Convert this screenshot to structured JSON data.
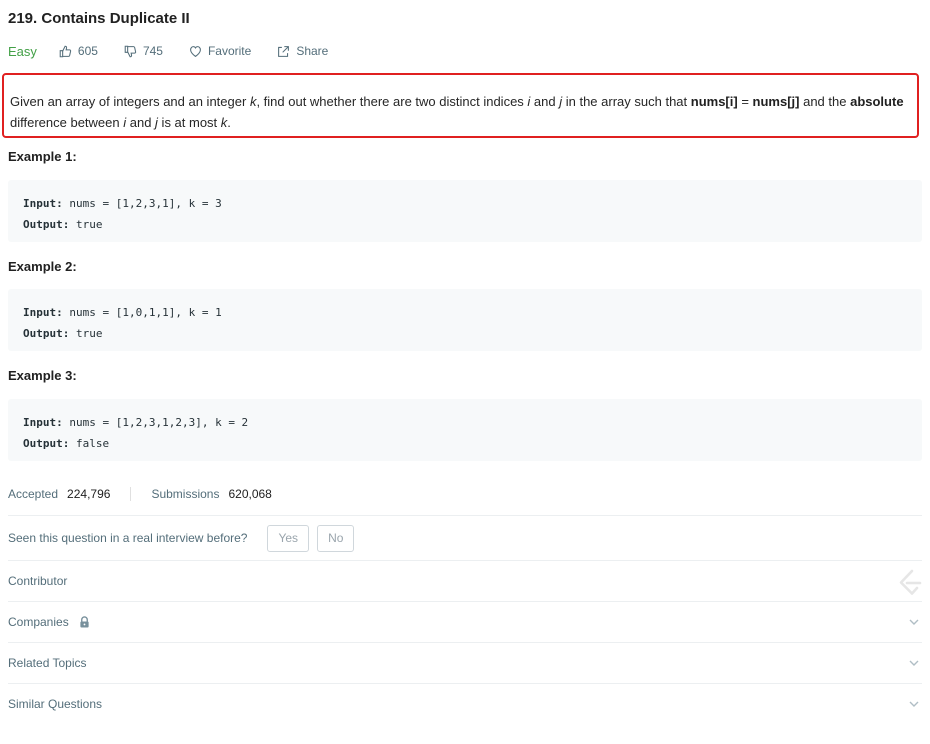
{
  "problem": {
    "title": "219. Contains Duplicate II",
    "difficulty": "Easy",
    "likes": "605",
    "dislikes": "745",
    "favorite_label": "Favorite",
    "share_label": "Share"
  },
  "description": {
    "t1": "Given an array of integers and an integer ",
    "k1": "k",
    "t2": ", find out whether there are two distinct indices ",
    "i1": "i",
    "t3": " and ",
    "j1": "j",
    "t4": " in the array such that ",
    "b1": "nums[i]",
    "t5": " = ",
    "b2": "nums[j]",
    "t6": " and the ",
    "b3": "absolute",
    "t7": " difference between ",
    "i2": "i",
    "t8": " and ",
    "j2": "j",
    "t9": " is at most ",
    "k2": "k",
    "t10": "."
  },
  "examples": [
    {
      "title": "Example 1:",
      "input_label": "Input:",
      "input": " nums = [1,2,3,1], k = 3",
      "output_label": "Output:",
      "output": " true"
    },
    {
      "title": "Example 2:",
      "input_label": "Input:",
      "input": " nums = [1,0,1,1], k = 1",
      "output_label": "Output:",
      "output": " true"
    },
    {
      "title": "Example 3:",
      "input_label": "Input:",
      "input": " nums = [1,2,3,1,2,3], k = 2",
      "output_label": "Output:",
      "output": " false"
    }
  ],
  "stats": {
    "accepted_label": "Accepted",
    "accepted_value": "224,796",
    "submissions_label": "Submissions",
    "submissions_value": "620,068"
  },
  "interview": {
    "question": "Seen this question in a real interview before?",
    "yes": "Yes",
    "no": "No"
  },
  "sections": {
    "contributor": "Contributor",
    "companies": "Companies",
    "related_topics": "Related Topics",
    "similar_questions": "Similar Questions"
  },
  "colors": {
    "easy": "#43a047",
    "highlight_border": "#e02020",
    "code_bg": "#f7f9fa"
  }
}
